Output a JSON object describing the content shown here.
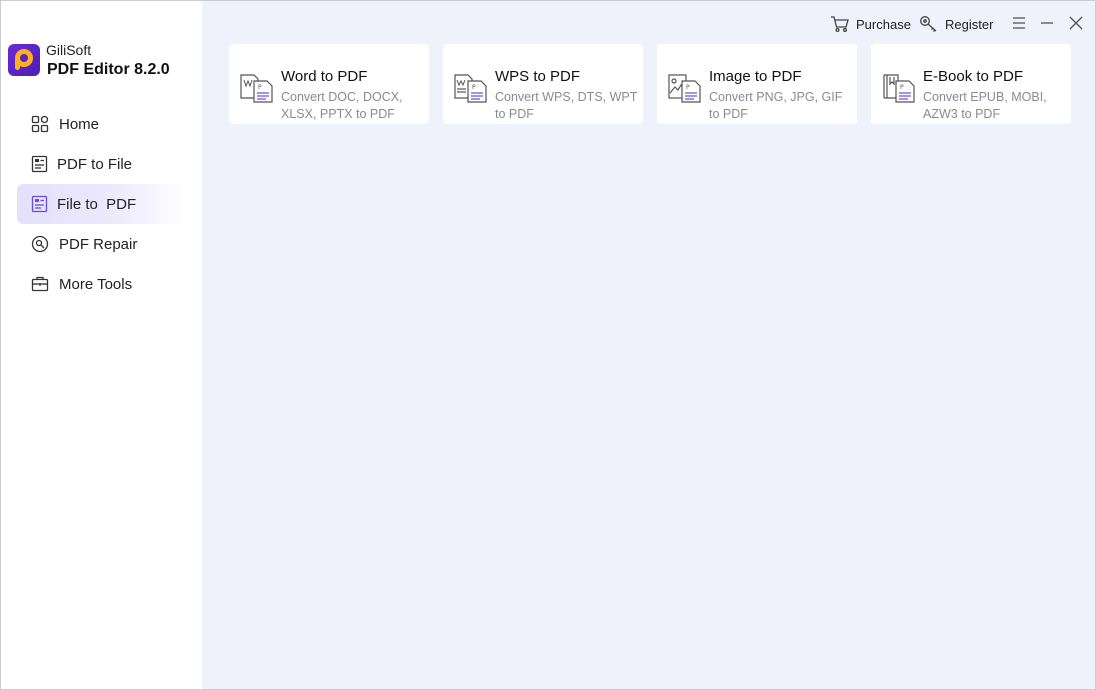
{
  "app": {
    "brand_small": "GiliSoft",
    "brand_big": "PDF Editor 8.2.0"
  },
  "topbar": {
    "purchase_label": "Purchase",
    "register_label": "Register"
  },
  "sidebar": {
    "items": [
      {
        "label": "Home",
        "icon": "home-grid-icon",
        "active": false
      },
      {
        "label": "PDF to File",
        "icon": "pdf-to-file-icon",
        "active": false
      },
      {
        "label": "File to  PDF",
        "icon": "file-to-pdf-icon",
        "active": true
      },
      {
        "label": "PDF Repair",
        "icon": "repair-icon",
        "active": false
      },
      {
        "label": "More Tools",
        "icon": "toolbox-icon",
        "active": false
      }
    ]
  },
  "cards": [
    {
      "title": "Word to PDF",
      "desc": "Convert DOC, DOCX, XLSX, PPTX to PDF",
      "icon": "word-doc-icon"
    },
    {
      "title": "WPS to PDF",
      "desc": "Convert WPS, DTS, WPT to PDF",
      "icon": "wps-doc-icon"
    },
    {
      "title": "Image to PDF",
      "desc": "Convert PNG, JPG, GIF to PDF",
      "icon": "image-doc-icon"
    },
    {
      "title": "E-Book to PDF",
      "desc": "Convert EPUB, MOBI, AZW3 to PDF",
      "icon": "ebook-doc-icon"
    }
  ],
  "colors": {
    "accent": "#6a4bd8",
    "sidebar_active_bg": "#e4e0fb",
    "content_bg": "#f0f2fb",
    "desc_text": "#8a8a96"
  }
}
